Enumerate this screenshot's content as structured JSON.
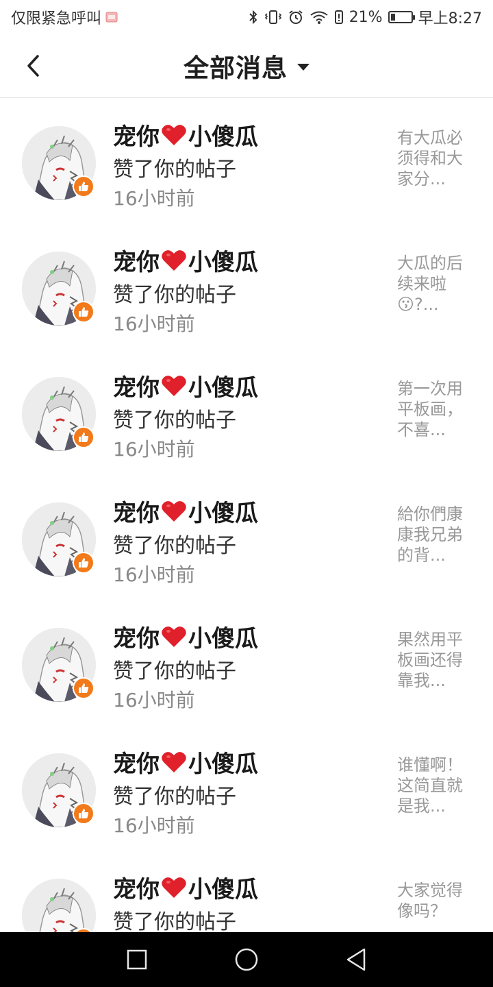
{
  "status_bar": {
    "left_text": "仅限紧急呼叫",
    "battery_percent": "21%",
    "battery_level": 0.21,
    "time": "早上8:27",
    "icons": [
      "bluetooth-icon",
      "vibrate-icon",
      "alarm-icon",
      "wifi-icon",
      "battery-alert-icon",
      "battery-icon"
    ]
  },
  "header": {
    "title": "全部消息"
  },
  "accent_color": "#f27a1a",
  "messages": [
    {
      "name_before": "宠你",
      "name_after": "小傻瓜",
      "action": "赞了你的帖子",
      "time": "16小时前",
      "preview": "有大瓜必须得和大家分..."
    },
    {
      "name_before": "宠你",
      "name_after": "小傻瓜",
      "action": "赞了你的帖子",
      "time": "16小时前",
      "preview": "大瓜的后续来啦😗?..."
    },
    {
      "name_before": "宠你",
      "name_after": "小傻瓜",
      "action": "赞了你的帖子",
      "time": "16小时前",
      "preview": "第一次用平板画，不喜..."
    },
    {
      "name_before": "宠你",
      "name_after": "小傻瓜",
      "action": "赞了你的帖子",
      "time": "16小时前",
      "preview": "給你們康康我兄弟的背..."
    },
    {
      "name_before": "宠你",
      "name_after": "小傻瓜",
      "action": "赞了你的帖子",
      "time": "16小时前",
      "preview": "果然用平板画还得靠我..."
    },
    {
      "name_before": "宠你",
      "name_after": "小傻瓜",
      "action": "赞了你的帖子",
      "time": "16小时前",
      "preview": "谁懂啊！这简直就是我..."
    },
    {
      "name_before": "宠你",
      "name_after": "小傻瓜",
      "action": "赞了你的帖子",
      "time": "",
      "preview": "大家觉得像吗？"
    }
  ],
  "nav_bar": {
    "icons": [
      "recent-apps-icon",
      "home-icon",
      "back-icon"
    ]
  }
}
